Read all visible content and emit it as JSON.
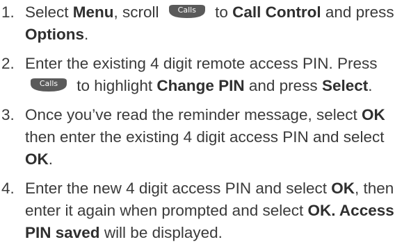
{
  "steps": [
    {
      "number": "1.",
      "parts": [
        {
          "type": "text",
          "value": "Select "
        },
        {
          "type": "bold",
          "value": "Menu"
        },
        {
          "type": "text",
          "value": ", scroll "
        },
        {
          "type": "key",
          "value": "Calls",
          "icon": "calls-key-icon"
        },
        {
          "type": "text",
          "value": " to "
        },
        {
          "type": "bold",
          "value": "Call Control"
        },
        {
          "type": "text",
          "value": " and press "
        },
        {
          "type": "bold",
          "value": "Options"
        },
        {
          "type": "text",
          "value": "."
        }
      ]
    },
    {
      "number": "2.",
      "parts": [
        {
          "type": "text",
          "value": "Enter the existing 4 digit remote access PIN. Press "
        },
        {
          "type": "key",
          "value": "Calls",
          "icon": "calls-key-icon"
        },
        {
          "type": "text",
          "value": " to highlight "
        },
        {
          "type": "bold",
          "value": "Change PIN"
        },
        {
          "type": "text",
          "value": " and press "
        },
        {
          "type": "bold",
          "value": "Select"
        },
        {
          "type": "text",
          "value": "."
        }
      ]
    },
    {
      "number": "3.",
      "parts": [
        {
          "type": "text",
          "value": "Once you’ve read the reminder message, select "
        },
        {
          "type": "bold",
          "value": "OK"
        },
        {
          "type": "text",
          "value": " then enter the existing 4 digit access PIN and select "
        },
        {
          "type": "bold",
          "value": "OK"
        },
        {
          "type": "text",
          "value": "."
        }
      ]
    },
    {
      "number": "4.",
      "parts": [
        {
          "type": "text",
          "value": "Enter the new 4 digit access PIN and select "
        },
        {
          "type": "bold",
          "value": "OK"
        },
        {
          "type": "text",
          "value": ", then enter it again when prompted and select "
        },
        {
          "type": "bold",
          "value": "OK. Access PIN saved"
        },
        {
          "type": "text",
          "value": " will be displayed."
        }
      ]
    }
  ],
  "colors": {
    "text": "#3a3a3a",
    "key_fill": "#5a5a5a",
    "key_text": "#ffffff"
  }
}
